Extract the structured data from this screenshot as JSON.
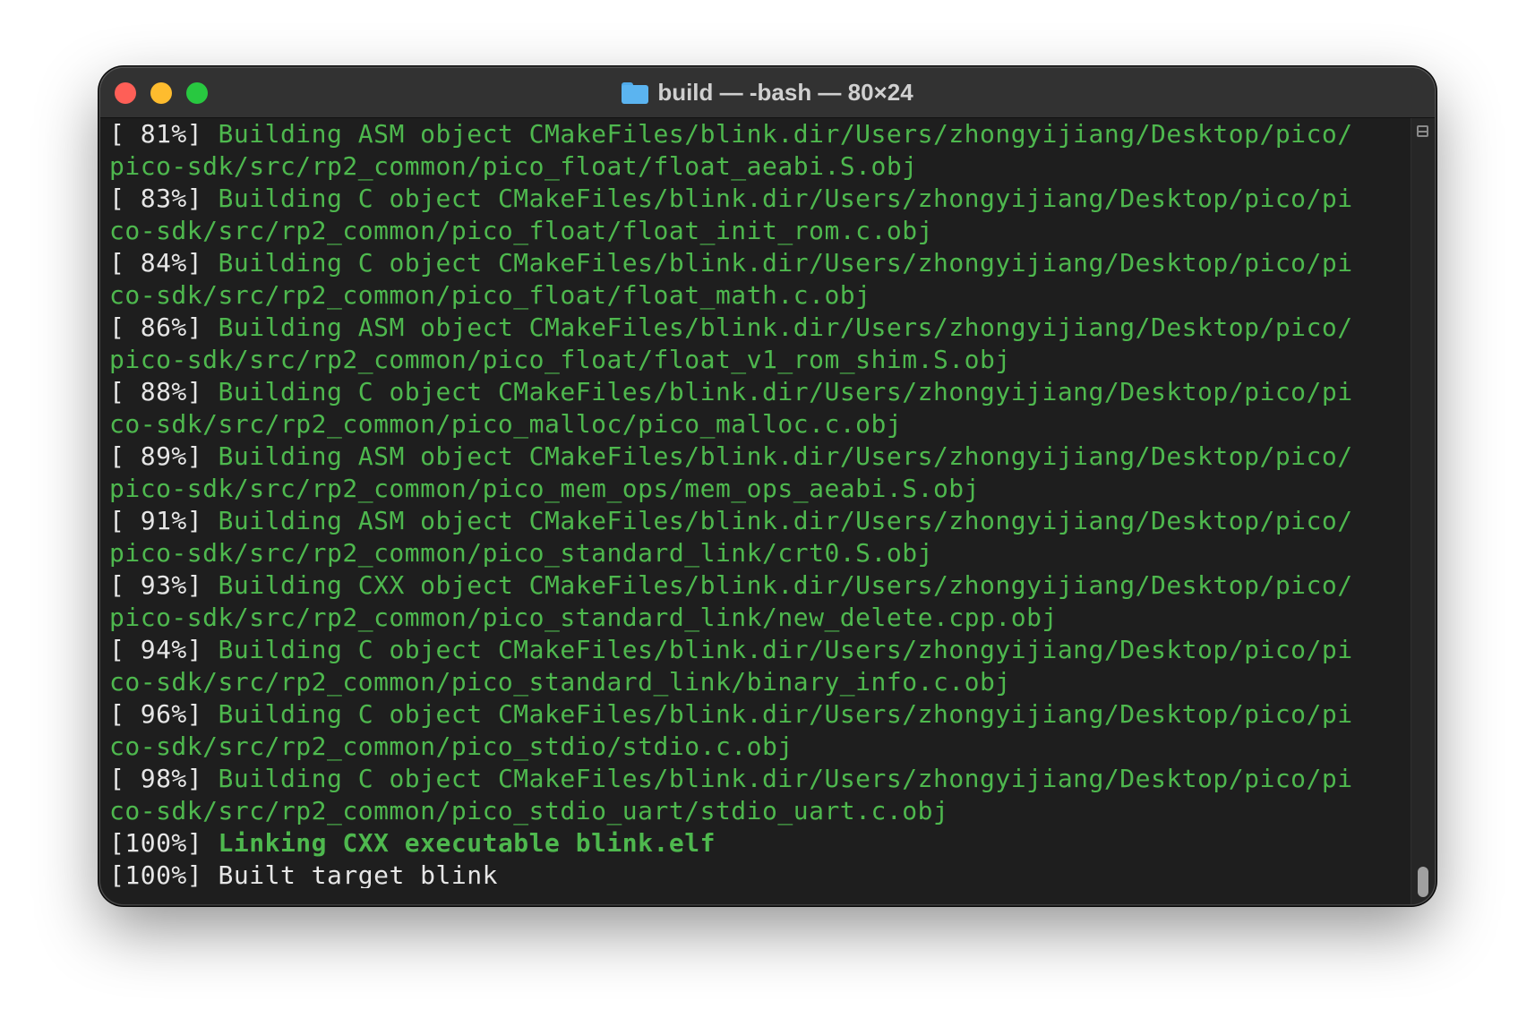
{
  "window": {
    "title": "build — -bash — 80×24"
  },
  "lines": [
    {
      "pct": "[ 81%] ",
      "msg": "Building ASM object CMakeFiles/blink.dir/Users/zhongyijiang/Desktop/pico/"
    },
    {
      "pct": "",
      "msg": "pico-sdk/src/rp2_common/pico_float/float_aeabi.S.obj"
    },
    {
      "pct": "[ 83%] ",
      "msg": "Building C object CMakeFiles/blink.dir/Users/zhongyijiang/Desktop/pico/pi"
    },
    {
      "pct": "",
      "msg": "co-sdk/src/rp2_common/pico_float/float_init_rom.c.obj"
    },
    {
      "pct": "[ 84%] ",
      "msg": "Building C object CMakeFiles/blink.dir/Users/zhongyijiang/Desktop/pico/pi"
    },
    {
      "pct": "",
      "msg": "co-sdk/src/rp2_common/pico_float/float_math.c.obj"
    },
    {
      "pct": "[ 86%] ",
      "msg": "Building ASM object CMakeFiles/blink.dir/Users/zhongyijiang/Desktop/pico/"
    },
    {
      "pct": "",
      "msg": "pico-sdk/src/rp2_common/pico_float/float_v1_rom_shim.S.obj"
    },
    {
      "pct": "[ 88%] ",
      "msg": "Building C object CMakeFiles/blink.dir/Users/zhongyijiang/Desktop/pico/pi"
    },
    {
      "pct": "",
      "msg": "co-sdk/src/rp2_common/pico_malloc/pico_malloc.c.obj"
    },
    {
      "pct": "[ 89%] ",
      "msg": "Building ASM object CMakeFiles/blink.dir/Users/zhongyijiang/Desktop/pico/"
    },
    {
      "pct": "",
      "msg": "pico-sdk/src/rp2_common/pico_mem_ops/mem_ops_aeabi.S.obj"
    },
    {
      "pct": "[ 91%] ",
      "msg": "Building ASM object CMakeFiles/blink.dir/Users/zhongyijiang/Desktop/pico/"
    },
    {
      "pct": "",
      "msg": "pico-sdk/src/rp2_common/pico_standard_link/crt0.S.obj"
    },
    {
      "pct": "[ 93%] ",
      "msg": "Building CXX object CMakeFiles/blink.dir/Users/zhongyijiang/Desktop/pico/"
    },
    {
      "pct": "",
      "msg": "pico-sdk/src/rp2_common/pico_standard_link/new_delete.cpp.obj"
    },
    {
      "pct": "[ 94%] ",
      "msg": "Building C object CMakeFiles/blink.dir/Users/zhongyijiang/Desktop/pico/pi"
    },
    {
      "pct": "",
      "msg": "co-sdk/src/rp2_common/pico_standard_link/binary_info.c.obj"
    },
    {
      "pct": "[ 96%] ",
      "msg": "Building C object CMakeFiles/blink.dir/Users/zhongyijiang/Desktop/pico/pi"
    },
    {
      "pct": "",
      "msg": "co-sdk/src/rp2_common/pico_stdio/stdio.c.obj"
    },
    {
      "pct": "[ 98%] ",
      "msg": "Building C object CMakeFiles/blink.dir/Users/zhongyijiang/Desktop/pico/pi"
    },
    {
      "pct": "",
      "msg": "co-sdk/src/rp2_common/pico_stdio_uart/stdio_uart.c.obj"
    },
    {
      "pct": "[100%] ",
      "msg": "Linking CXX executable blink.elf"
    },
    {
      "pct": "[100%] ",
      "msg": "Built target blink"
    }
  ],
  "colors": {
    "green": "#4eb84e",
    "text": "#e6e6e6",
    "background": "#1e1e1e"
  },
  "icons": {
    "title": "folder-icon",
    "scrollbar": "split-pane-icon"
  }
}
